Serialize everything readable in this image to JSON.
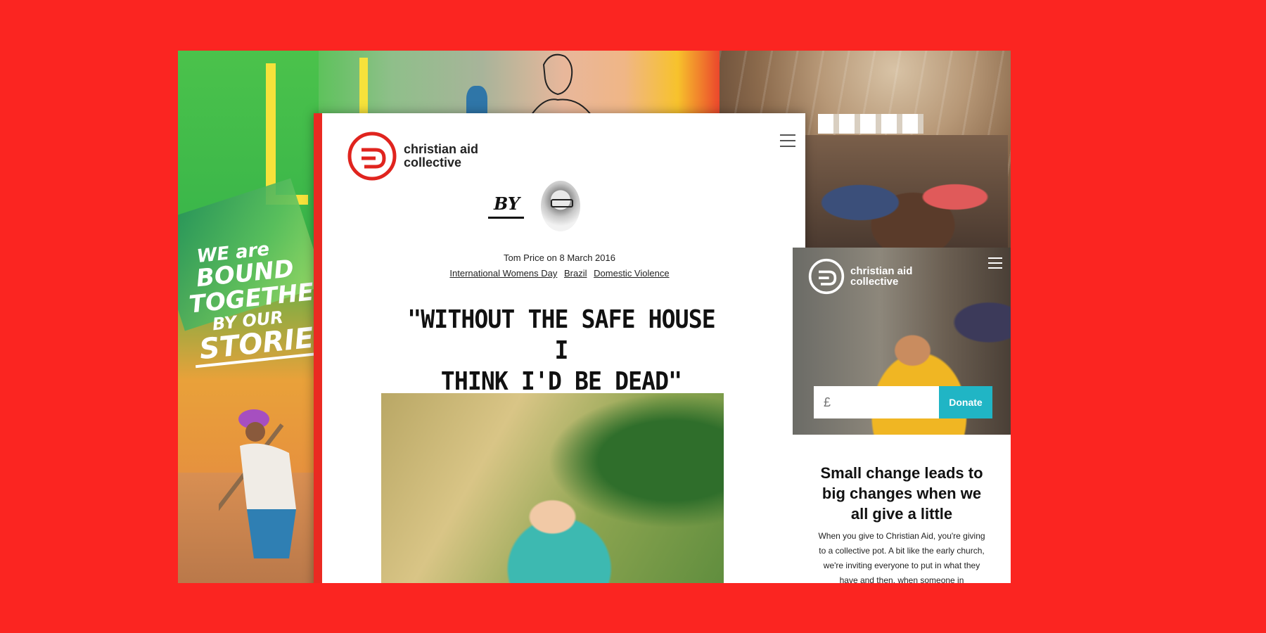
{
  "brand": {
    "name_line1": "christian aid",
    "name_line2": "collective",
    "accent_color": "#ea2a22",
    "background_color": "#fb2521",
    "donate_color": "#20b5c5"
  },
  "poster": {
    "slogan_line1": "WE are",
    "slogan_line2": "BOUND",
    "slogan_line3": "TOGETHER",
    "slogan_line4": "BY OUR",
    "slogan_line5": "STORIES"
  },
  "article": {
    "by_label": "BY",
    "author_date": "Tom Price on 8 March 2016",
    "tags": [
      "International Womens Day",
      "Brazil",
      "Domestic Violence"
    ],
    "headline_line1": "\"WITHOUT THE SAFE HOUSE I",
    "headline_line2": "THINK I'D BE DEAD\""
  },
  "mobile": {
    "amount_placeholder": "£",
    "donate_label": "Donate",
    "title": "Small change leads to big changes when we all give a little",
    "body": "When you give to Christian Aid, you're giving to a collective pot. A bit like the early church, we're inviting everyone to put in what they have and then, when someone in"
  },
  "icons": {
    "menu": "hamburger-menu-icon",
    "logo": "christian-aid-logo-icon"
  }
}
